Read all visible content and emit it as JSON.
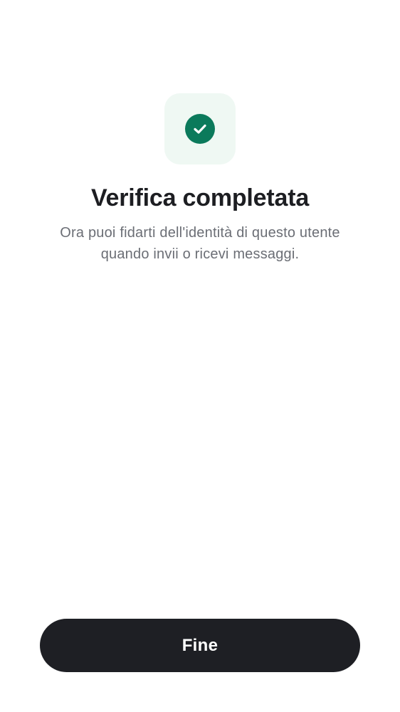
{
  "status_icon": {
    "name": "check-circle-icon",
    "tile_color": "#eff8f3",
    "circle_color": "#0b7a5b"
  },
  "title": "Verifica completata",
  "subtitle_line1": "Ora puoi fidarti dell'identità di questo utente",
  "subtitle_line2": "quando invii o ricevi messaggi.",
  "done_button": {
    "label": "Fine",
    "color": "#1e1f24"
  }
}
